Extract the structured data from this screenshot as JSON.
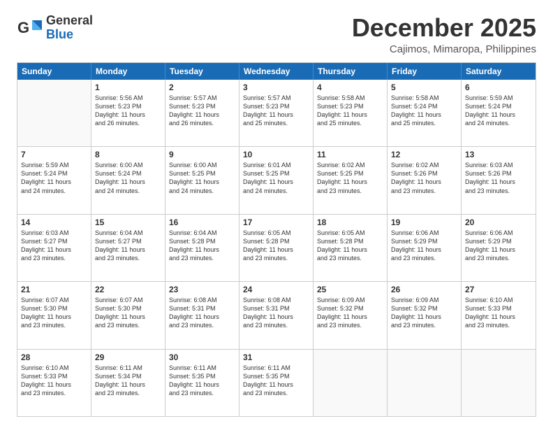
{
  "header": {
    "logo_line1": "General",
    "logo_line2": "Blue",
    "month": "December 2025",
    "location": "Cajimos, Mimaropa, Philippines"
  },
  "weekdays": [
    "Sunday",
    "Monday",
    "Tuesday",
    "Wednesday",
    "Thursday",
    "Friday",
    "Saturday"
  ],
  "weeks": [
    [
      {
        "day": "",
        "info": ""
      },
      {
        "day": "1",
        "info": "Sunrise: 5:56 AM\nSunset: 5:23 PM\nDaylight: 11 hours\nand 26 minutes."
      },
      {
        "day": "2",
        "info": "Sunrise: 5:57 AM\nSunset: 5:23 PM\nDaylight: 11 hours\nand 26 minutes."
      },
      {
        "day": "3",
        "info": "Sunrise: 5:57 AM\nSunset: 5:23 PM\nDaylight: 11 hours\nand 25 minutes."
      },
      {
        "day": "4",
        "info": "Sunrise: 5:58 AM\nSunset: 5:23 PM\nDaylight: 11 hours\nand 25 minutes."
      },
      {
        "day": "5",
        "info": "Sunrise: 5:58 AM\nSunset: 5:24 PM\nDaylight: 11 hours\nand 25 minutes."
      },
      {
        "day": "6",
        "info": "Sunrise: 5:59 AM\nSunset: 5:24 PM\nDaylight: 11 hours\nand 24 minutes."
      }
    ],
    [
      {
        "day": "7",
        "info": "Sunrise: 5:59 AM\nSunset: 5:24 PM\nDaylight: 11 hours\nand 24 minutes."
      },
      {
        "day": "8",
        "info": "Sunrise: 6:00 AM\nSunset: 5:24 PM\nDaylight: 11 hours\nand 24 minutes."
      },
      {
        "day": "9",
        "info": "Sunrise: 6:00 AM\nSunset: 5:25 PM\nDaylight: 11 hours\nand 24 minutes."
      },
      {
        "day": "10",
        "info": "Sunrise: 6:01 AM\nSunset: 5:25 PM\nDaylight: 11 hours\nand 24 minutes."
      },
      {
        "day": "11",
        "info": "Sunrise: 6:02 AM\nSunset: 5:25 PM\nDaylight: 11 hours\nand 23 minutes."
      },
      {
        "day": "12",
        "info": "Sunrise: 6:02 AM\nSunset: 5:26 PM\nDaylight: 11 hours\nand 23 minutes."
      },
      {
        "day": "13",
        "info": "Sunrise: 6:03 AM\nSunset: 5:26 PM\nDaylight: 11 hours\nand 23 minutes."
      }
    ],
    [
      {
        "day": "14",
        "info": "Sunrise: 6:03 AM\nSunset: 5:27 PM\nDaylight: 11 hours\nand 23 minutes."
      },
      {
        "day": "15",
        "info": "Sunrise: 6:04 AM\nSunset: 5:27 PM\nDaylight: 11 hours\nand 23 minutes."
      },
      {
        "day": "16",
        "info": "Sunrise: 6:04 AM\nSunset: 5:28 PM\nDaylight: 11 hours\nand 23 minutes."
      },
      {
        "day": "17",
        "info": "Sunrise: 6:05 AM\nSunset: 5:28 PM\nDaylight: 11 hours\nand 23 minutes."
      },
      {
        "day": "18",
        "info": "Sunrise: 6:05 AM\nSunset: 5:28 PM\nDaylight: 11 hours\nand 23 minutes."
      },
      {
        "day": "19",
        "info": "Sunrise: 6:06 AM\nSunset: 5:29 PM\nDaylight: 11 hours\nand 23 minutes."
      },
      {
        "day": "20",
        "info": "Sunrise: 6:06 AM\nSunset: 5:29 PM\nDaylight: 11 hours\nand 23 minutes."
      }
    ],
    [
      {
        "day": "21",
        "info": "Sunrise: 6:07 AM\nSunset: 5:30 PM\nDaylight: 11 hours\nand 23 minutes."
      },
      {
        "day": "22",
        "info": "Sunrise: 6:07 AM\nSunset: 5:30 PM\nDaylight: 11 hours\nand 23 minutes."
      },
      {
        "day": "23",
        "info": "Sunrise: 6:08 AM\nSunset: 5:31 PM\nDaylight: 11 hours\nand 23 minutes."
      },
      {
        "day": "24",
        "info": "Sunrise: 6:08 AM\nSunset: 5:31 PM\nDaylight: 11 hours\nand 23 minutes."
      },
      {
        "day": "25",
        "info": "Sunrise: 6:09 AM\nSunset: 5:32 PM\nDaylight: 11 hours\nand 23 minutes."
      },
      {
        "day": "26",
        "info": "Sunrise: 6:09 AM\nSunset: 5:32 PM\nDaylight: 11 hours\nand 23 minutes."
      },
      {
        "day": "27",
        "info": "Sunrise: 6:10 AM\nSunset: 5:33 PM\nDaylight: 11 hours\nand 23 minutes."
      }
    ],
    [
      {
        "day": "28",
        "info": "Sunrise: 6:10 AM\nSunset: 5:33 PM\nDaylight: 11 hours\nand 23 minutes."
      },
      {
        "day": "29",
        "info": "Sunrise: 6:11 AM\nSunset: 5:34 PM\nDaylight: 11 hours\nand 23 minutes."
      },
      {
        "day": "30",
        "info": "Sunrise: 6:11 AM\nSunset: 5:35 PM\nDaylight: 11 hours\nand 23 minutes."
      },
      {
        "day": "31",
        "info": "Sunrise: 6:11 AM\nSunset: 5:35 PM\nDaylight: 11 hours\nand 23 minutes."
      },
      {
        "day": "",
        "info": ""
      },
      {
        "day": "",
        "info": ""
      },
      {
        "day": "",
        "info": ""
      }
    ]
  ]
}
